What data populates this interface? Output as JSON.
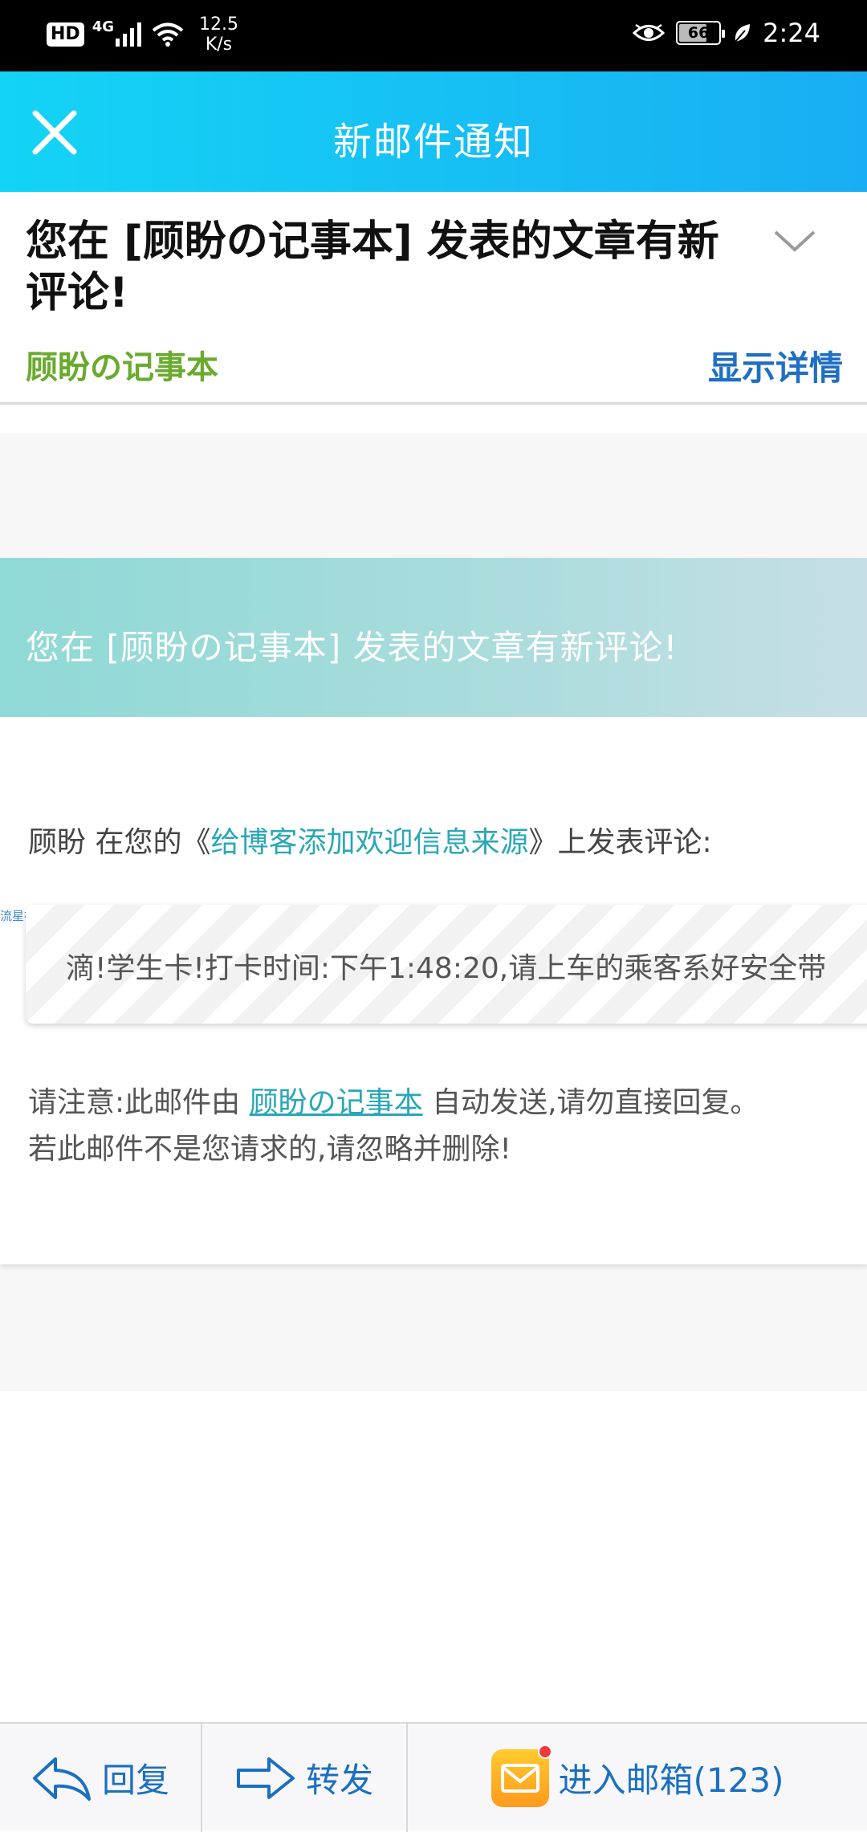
{
  "status_bar": {
    "hd": "HD",
    "network": "4G",
    "speed_value": "12.5",
    "speed_unit": "K/s",
    "battery": "66",
    "time": "2:24"
  },
  "title_bar": {
    "title": "新邮件通知"
  },
  "header": {
    "subject": "您在 [顾盼の记事本] 发表的文章有新评论!",
    "sender": "顾盼の记事本",
    "details_label": "显示详情"
  },
  "body": {
    "banner_text": "您在 [顾盼の记事本] 发表的文章有新评论!",
    "comment_prefix": "顾盼 在您的《",
    "article_title": "给博客添加欢迎信息来源",
    "comment_suffix": "》上发表评论:",
    "source_label": "流星社区",
    "quote": "滴!学生卡!打卡时间:下午1:48:20,请上车的乘客系好安全带",
    "notice_prefix": "请注意:此邮件由",
    "notice_link": "顾盼の记事本",
    "notice_suffix": "自动发送,请勿直接回复。",
    "notice_line2": "若此邮件不是您请求的,请忽略并删除!"
  },
  "bottom_bar": {
    "reply_label": "回复",
    "forward_label": "转发",
    "mailbox_label": "进入邮箱(123)"
  },
  "colors": {
    "title_gradient_start": "#13d4f5",
    "title_gradient_end": "#19aef3",
    "sender_green": "#6aaa2e",
    "link_blue": "#1f6fc3",
    "teal_link": "#2aa7b6"
  }
}
